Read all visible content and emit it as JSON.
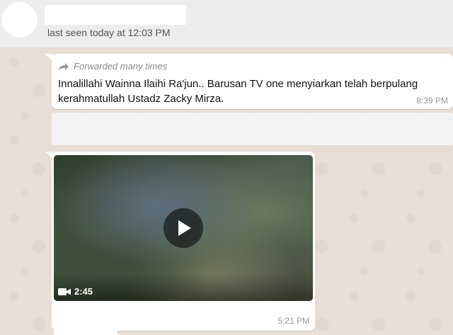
{
  "header": {
    "last_seen": "last seen today at 12:03 PM"
  },
  "messages": [
    {
      "forwarded_label": "Forwarded many times",
      "text": "Innalillahi Wainna Ilaihi Ra'jun.. Barusan TV one menyiarkan telah berpulang kerahmatullah Ustadz Zacky Mirza.",
      "time": "8:39 PM"
    },
    {
      "video_duration": "2:45",
      "time": "5:21 PM"
    }
  ],
  "icons": {
    "forward": "forward-arrow-icon",
    "play": "play-icon",
    "video": "video-camera-icon"
  },
  "colors": {
    "chat_background": "#e5ddd5",
    "bubble": "#ffffff",
    "header": "#ededed"
  }
}
